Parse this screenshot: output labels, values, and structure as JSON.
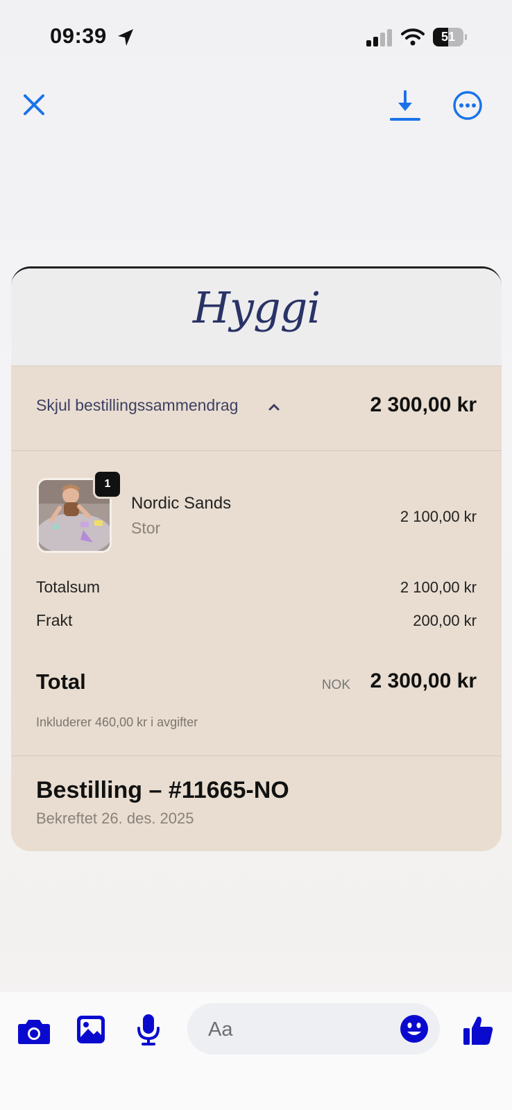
{
  "status_bar": {
    "time": "09:39",
    "battery": "51",
    "battery_level": 0.51
  },
  "top_bar": {
    "close_icon": "close-icon",
    "download_icon": "download-icon",
    "more_icon": "more-icon"
  },
  "receipt": {
    "logo_text": "Hyggi",
    "summary_toggle_label": "Skjul bestillingssammendrag",
    "summary_total": "2 300,00 kr",
    "item": {
      "quantity": "1",
      "name": "Nordic Sands",
      "variant": "Stor",
      "price": "2 100,00 kr"
    },
    "subtotal_label": "Totalsum",
    "subtotal_value": "2 100,00 kr",
    "shipping_label": "Frakt",
    "shipping_value": "200,00 kr",
    "total_label": "Total",
    "total_currency": "NOK",
    "total_value": "2 300,00 kr",
    "fees_note": "Inkluderer 460,00 kr i avgifter",
    "order_title": "Bestilling – #11665-NO",
    "order_confirmed": "Bekreftet 26. des. 2025"
  },
  "composer": {
    "placeholder": "Aa"
  },
  "colors": {
    "accent_blue": "#1a73e8",
    "composer_blue": "#0a0acf",
    "card_bg": "#e8ddd0",
    "logo_navy": "#2a3366"
  }
}
